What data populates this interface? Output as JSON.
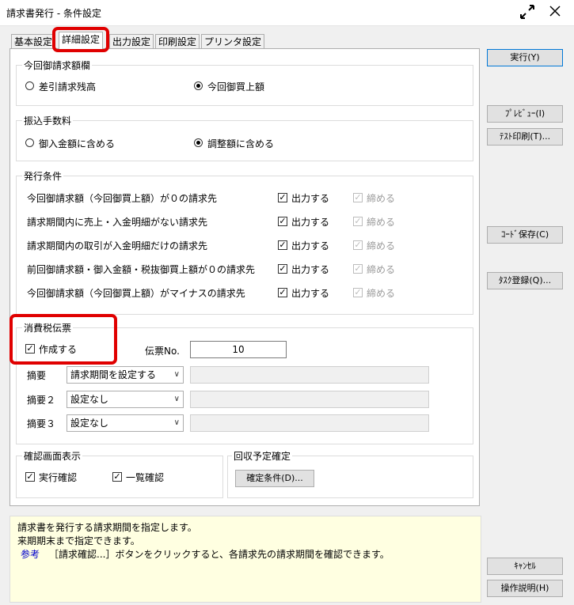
{
  "window": {
    "title": "請求書発行 - 条件設定"
  },
  "icons": {
    "resize": "resize-arrows-icon",
    "close": "close-icon"
  },
  "tabs": [
    "基本設定",
    "詳細設定",
    "出力設定",
    "印刷設定",
    "プリンタ設定"
  ],
  "this_period": {
    "legend": "今回御請求額欄",
    "options": [
      "差引請求残高",
      "今回御買上額"
    ],
    "selected": "今回御買上額"
  },
  "transfer_fee": {
    "legend": "振込手数料",
    "options": [
      "御入金額に含める",
      "調整額に含める"
    ],
    "selected": "調整額に含める"
  },
  "issue_conditions": {
    "legend": "発行条件",
    "output_label": "出力する",
    "close_label": "締める",
    "rows": [
      {
        "label": "今回御請求額（今回御買上額）が０の請求先",
        "output": true,
        "close": true
      },
      {
        "label": "請求期間内に売上・入金明細がない請求先",
        "output": true,
        "close": true
      },
      {
        "label": "請求期間内の取引が入金明細だけの請求先",
        "output": true,
        "close": true
      },
      {
        "label": "前回御請求額・御入金額・税抜御買上額が０の請求先",
        "output": true,
        "close": true
      },
      {
        "label": "今回御請求額（今回御買上額）がマイナスの請求先",
        "output": true,
        "close": true
      }
    ]
  },
  "tax_slip": {
    "legend": "消費税伝票",
    "create_label": "作成する",
    "create_checked": true,
    "slip_no_label": "伝票No.",
    "slip_no_value": "10",
    "summaries": [
      {
        "label": "摘要",
        "value": "請求期間を設定する"
      },
      {
        "label": "摘要２",
        "value": "設定なし"
      },
      {
        "label": "摘要３",
        "value": "設定なし"
      }
    ]
  },
  "confirm_display": {
    "legend": "確認画面表示",
    "exec_label": "実行確認",
    "exec_checked": true,
    "list_label": "一覧確認",
    "list_checked": true
  },
  "collection": {
    "legend": "回収予定確定",
    "button": "確定条件(D)..."
  },
  "buttons": {
    "execute": "実行(Y)",
    "preview": "ﾌﾟﾚﾋﾞｭｰ(I)",
    "test_print": "ﾃｽﾄ印刷(T)...",
    "code_save": "ｺｰﾄﾞ保存(C)",
    "task_register": "ﾀｽｸ登録(Q)...",
    "cancel": "ｷｬﾝｾﾙ",
    "help": "操作説明(H)"
  },
  "help": {
    "line1": "請求書を発行する請求期間を指定します。",
    "line2": "来期期末まで指定できます。",
    "ref_label": "参考",
    "ref_text": "［請求確認...］ボタンをクリックすると、各請求先の請求期間を確認できます。"
  },
  "colors": {
    "highlight": "#e00000",
    "help_bg": "#ffffe1",
    "ref_link": "#0000cc"
  }
}
